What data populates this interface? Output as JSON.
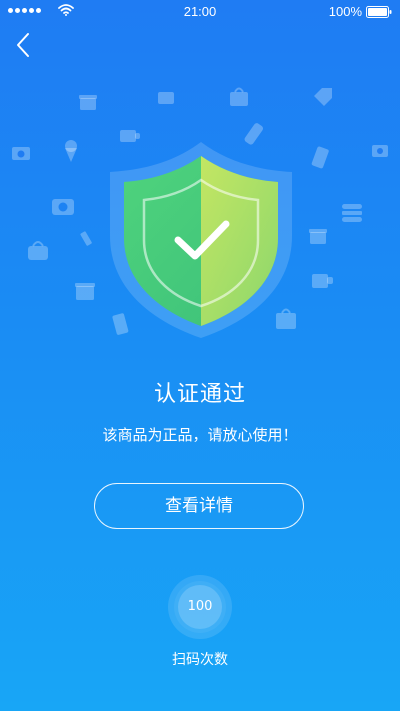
{
  "status_bar": {
    "time": "21:00",
    "battery": "100%",
    "signal_icon": "signal-dots-icon",
    "wifi_icon": "wifi-icon",
    "battery_icon": "battery-icon"
  },
  "nav": {
    "back_icon": "chevron-left-icon"
  },
  "result": {
    "title": "认证通过",
    "subtitle": "该商品为正品，请放心使用！",
    "badge_icon": "shield-check-icon"
  },
  "details_button": {
    "label": "查看详情"
  },
  "scan": {
    "count": "100",
    "label": "扫码次数"
  },
  "colors": {
    "background_top": "#1f7cf3",
    "background_bottom": "#18a6f6",
    "shield_green": "#52d17a",
    "shield_yellow": "#d6e75c",
    "text": "#ffffff"
  }
}
